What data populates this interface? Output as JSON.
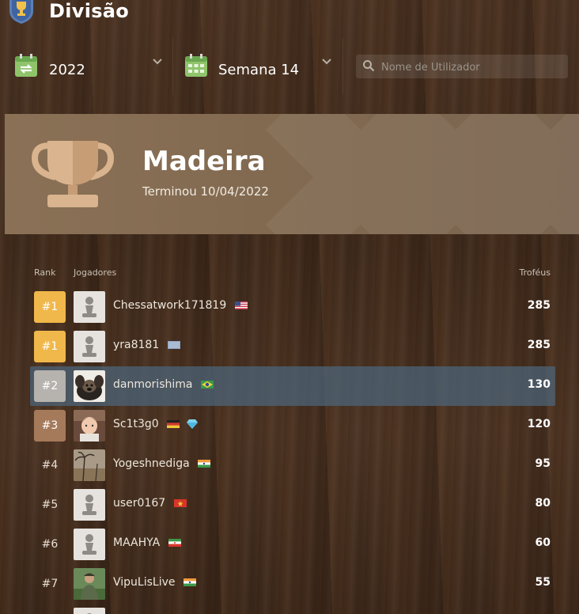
{
  "header": {
    "title": "Divisão"
  },
  "toolbar": {
    "year": "2022",
    "week": "Semana 14",
    "search_placeholder": "Nome de Utilizador"
  },
  "banner": {
    "league": "Madeira",
    "ended": "Terminou 10/04/2022"
  },
  "table": {
    "col_rank": "Rank",
    "col_players": "Jogadores",
    "col_trophies": "Troféus",
    "rows": [
      {
        "rank": "#1",
        "name": "Chessatwork171819",
        "trophies": "285",
        "flag": "us",
        "tier": "gold",
        "avatar": "pawn"
      },
      {
        "rank": "#1",
        "name": "yra8181",
        "trophies": "285",
        "flag": "intl",
        "tier": "gold",
        "avatar": "pawn"
      },
      {
        "rank": "#2",
        "name": "danmorishima",
        "trophies": "130",
        "flag": "br",
        "tier": "silver",
        "avatar": "photo-dog",
        "highlight": true
      },
      {
        "rank": "#3",
        "name": "Sc1t3g0",
        "trophies": "120",
        "flag": "de",
        "extra_icon": "diamond",
        "tier": "bronze",
        "avatar": "photo-baby"
      },
      {
        "rank": "#4",
        "name": "Yogeshnediga",
        "trophies": "95",
        "flag": "in",
        "tier": "plain",
        "avatar": "photo-beach"
      },
      {
        "rank": "#5",
        "name": "user0167",
        "trophies": "80",
        "flag": "vn",
        "tier": "plain",
        "avatar": "pawn"
      },
      {
        "rank": "#6",
        "name": "MAAHYA",
        "trophies": "60",
        "flag": "ir",
        "tier": "plain",
        "avatar": "pawn"
      },
      {
        "rank": "#7",
        "name": "VipuLisLive",
        "trophies": "55",
        "flag": "in",
        "tier": "plain",
        "avatar": "photo-person"
      }
    ]
  },
  "colors": {
    "gold": "#f0b84a",
    "silver": "#b6b2ad",
    "bronze": "#a57a5a",
    "highlight": "#4c6478",
    "banner": "#8a7156"
  }
}
